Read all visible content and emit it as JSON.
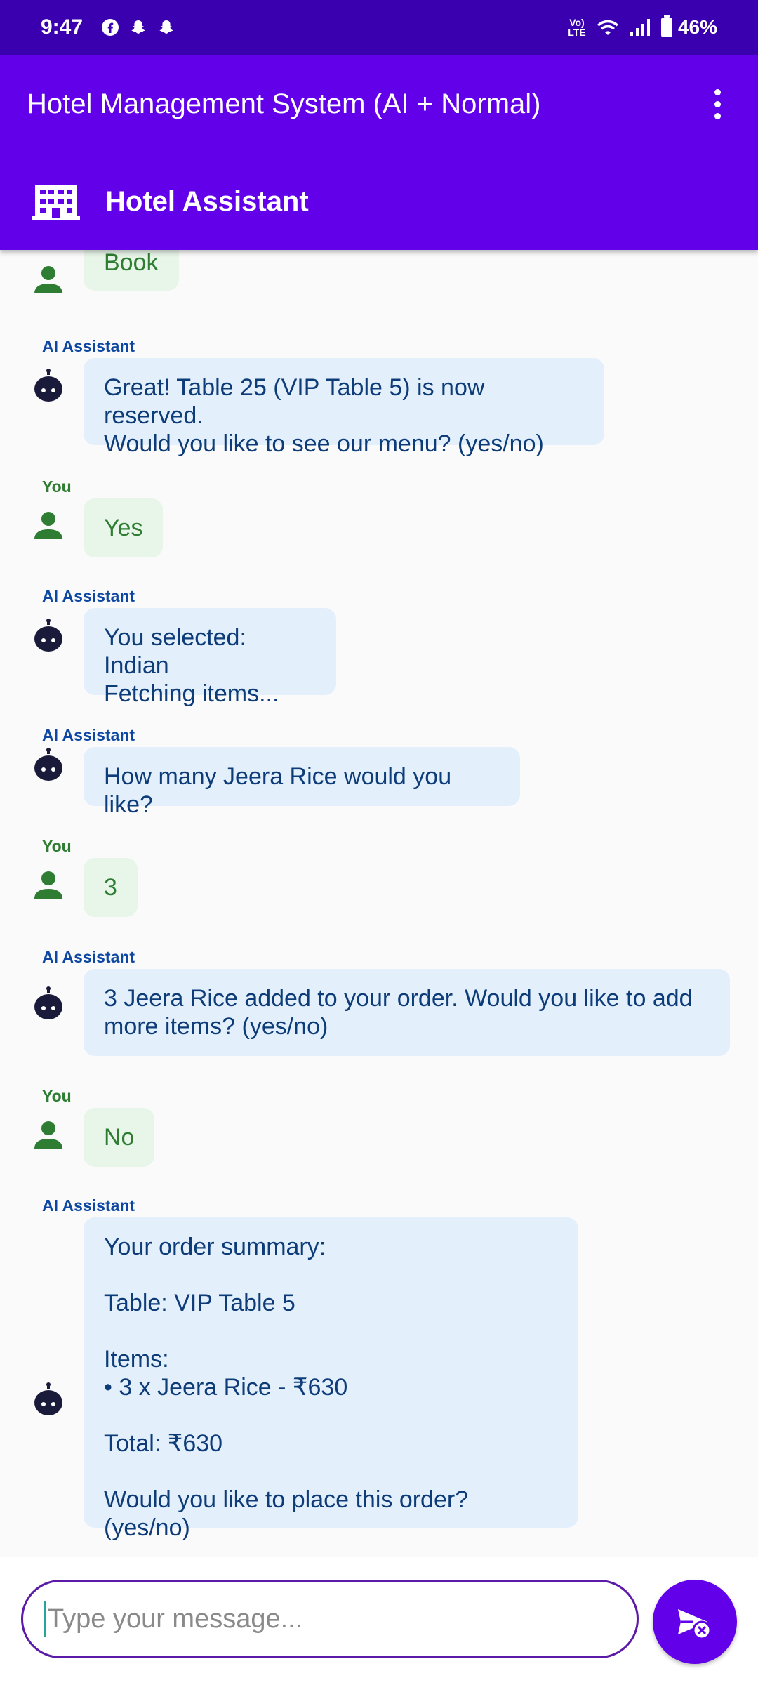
{
  "status_bar": {
    "time": "9:47",
    "network_label": "Vo) LTE",
    "battery": "46%"
  },
  "app_bar": {
    "title": "Hotel Management System (AI + Normal)"
  },
  "sub_header": {
    "title": "Hotel Assistant"
  },
  "messages": [
    {
      "sender": "",
      "role": "user",
      "text": "Book"
    },
    {
      "sender": "AI Assistant",
      "role": "ai",
      "text": "Great! Table 25 (VIP Table 5) is now reserved.\nWould you like to see our menu? (yes/no)"
    },
    {
      "sender": "You",
      "role": "user",
      "text": "Yes"
    },
    {
      "sender": "AI Assistant",
      "role": "ai",
      "text": "You selected: Indian\nFetching items..."
    },
    {
      "sender": "AI Assistant",
      "role": "ai",
      "text": "How many Jeera Rice would you like?"
    },
    {
      "sender": "You",
      "role": "user",
      "text": "3"
    },
    {
      "sender": "AI Assistant",
      "role": "ai",
      "text": "3 Jeera Rice added to your order. Would you like to add\nmore items? (yes/no)"
    },
    {
      "sender": "You",
      "role": "user",
      "text": "No"
    },
    {
      "sender": "AI Assistant",
      "role": "ai",
      "text": "Your order summary:\n\nTable: VIP Table 5\n\nItems:\n• 3 x Jeera Rice - ₹630\n\nTotal: ₹630\n\nWould you like to place this order? (yes/no)"
    }
  ],
  "input": {
    "placeholder": "Type your message..."
  },
  "colors": {
    "status_bar": "#3a00b0",
    "primary": "#6200ea",
    "ai_bubble": "#e3f0fc",
    "user_bubble": "#e8f5e9",
    "ai_sender": "#0d47a1",
    "user_sender": "#2e7d32"
  },
  "icons": {
    "status": [
      "facebook-icon",
      "snapchat-icon",
      "snapchat-icon",
      "wifi-icon",
      "signal-icon",
      "battery-icon"
    ],
    "header": "hotel-icon",
    "ai_avatar": "robot-icon",
    "user_avatar": "person-icon",
    "send": "send-icon",
    "menu": "more-vert-icon"
  }
}
